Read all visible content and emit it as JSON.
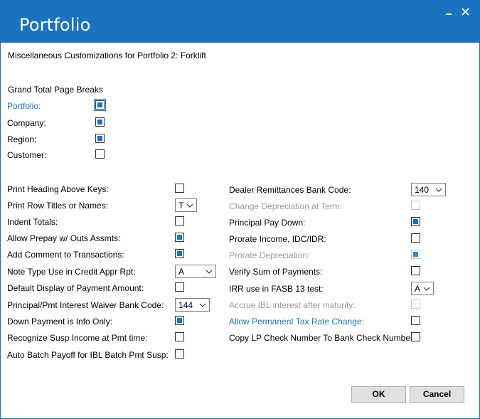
{
  "window": {
    "title": "Portfolio"
  },
  "header": {
    "subtitle": "Miscellaneous Customizations  for Portfolio  2: Forklift"
  },
  "page_breaks": {
    "heading": "Grand Total Page Breaks",
    "items": [
      {
        "label": "Portfolio:",
        "checked": true
      },
      {
        "label": "Company:",
        "checked": true
      },
      {
        "label": "Region:",
        "checked": true
      },
      {
        "label": "Customer:",
        "checked": false
      }
    ]
  },
  "left_options": {
    "print_heading_above_keys": "Print Heading Above Keys:",
    "print_row_titles": "Print Row Titles or Names:",
    "print_row_titles_value": "T",
    "indent_totals": "Indent Totals:",
    "allow_prepay": "Allow Prepay w/ Outs Assmts:",
    "add_comment": "Add Comment to Transactions:",
    "note_type": "Note Type Use in Credit Appr Rpt:",
    "note_type_value": "A",
    "default_display": "Default Display of Payment Amount:",
    "waiver_bank_code": "Principal/Pmt Interest Waiver Bank Code:",
    "waiver_bank_code_value": "144",
    "down_payment": "Down Payment is Info Only:",
    "recognize_susp": "Recognize Susp Income at Pmt time:",
    "auto_batch": "Auto Batch Payoff for IBL Batch Pmt Susp:"
  },
  "right_options": {
    "dealer_remittances": "Dealer Remittances Bank Code:",
    "dealer_remittances_value": "140",
    "change_depreciation": "Change Depreciation at Term:",
    "principal_pay_down": "Principal Pay Down:",
    "prorate_income": "Prorate Income, IDC/IDR:",
    "prorate_depreciation": "Prorate Depreciation:",
    "verify_sum": "Verify Sum of Payments:",
    "irr_use": "IRR use in FASB 13 test:",
    "irr_use_value": "A",
    "accrue_ibl": "Accrue IBL interest after maturity:",
    "allow_permanent_tax": "Allow Permanent Tax Rate Change:",
    "copy_lp_check": "Copy LP Check Number To Bank Check Number:"
  },
  "buttons": {
    "ok": "OK",
    "cancel": "Cancel"
  },
  "colors": {
    "accent": "#1a73c0",
    "disabled_text": "#9a9a9a"
  }
}
